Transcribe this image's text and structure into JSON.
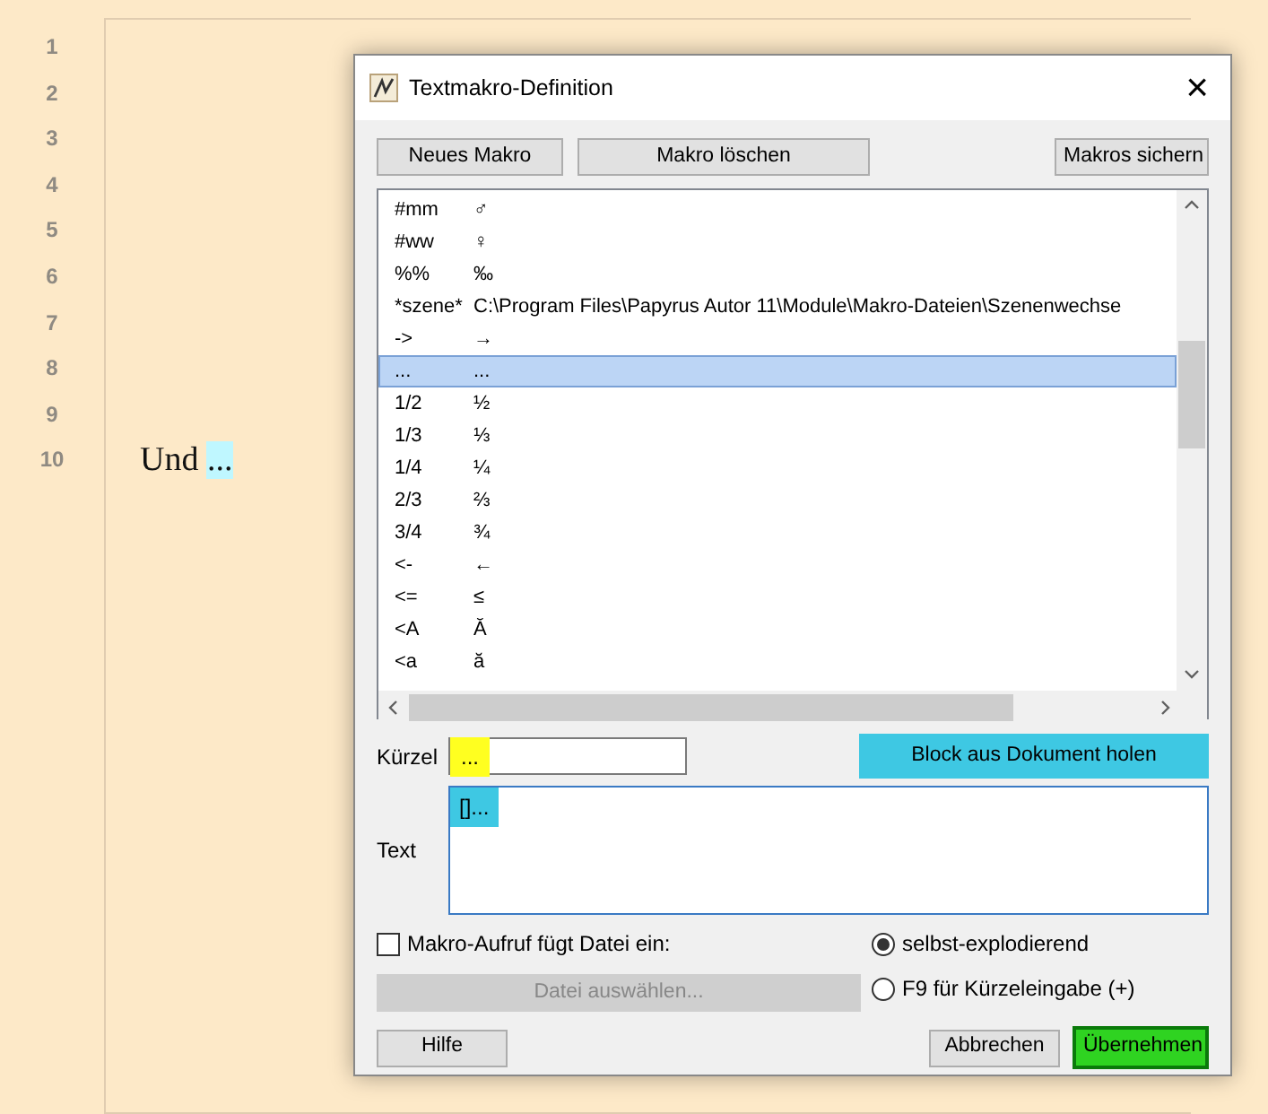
{
  "editor": {
    "line_numbers": [
      "1",
      "2",
      "3",
      "4",
      "5",
      "6",
      "7",
      "8",
      "9",
      "10"
    ],
    "text": "Und",
    "highlighted_text": "..."
  },
  "dialog": {
    "title": "Textmakro-Definition",
    "close": "×",
    "top_buttons": [
      "Neues Makro",
      "Makro löschen",
      "Makros sichern"
    ],
    "macros": [
      {
        "shortcut": "#mm",
        "text": "♂",
        "selected": false
      },
      {
        "shortcut": "#ww",
        "text": "♀",
        "selected": false
      },
      {
        "shortcut": "%%",
        "text": "‰",
        "selected": false
      },
      {
        "shortcut": "*szene*",
        "text": "C:\\Program Files\\Papyrus Autor 11\\Module\\Makro-Dateien\\Szenenwechse",
        "selected": false
      },
      {
        "shortcut": "->",
        "text": "→",
        "selected": false
      },
      {
        "shortcut": "...",
        "text": "...",
        "selected": true
      },
      {
        "shortcut": "1/2",
        "text": "½",
        "selected": false
      },
      {
        "shortcut": "1/3",
        "text": "⅓",
        "selected": false
      },
      {
        "shortcut": "1/4",
        "text": "¼",
        "selected": false
      },
      {
        "shortcut": "2/3",
        "text": "⅔",
        "selected": false
      },
      {
        "shortcut": "3/4",
        "text": "¾",
        "selected": false
      },
      {
        "shortcut": "<-",
        "text": "←",
        "selected": false
      },
      {
        "shortcut": "<=",
        "text": "≤",
        "selected": false
      },
      {
        "shortcut": "<A",
        "text": "Ă",
        "selected": false
      },
      {
        "shortcut": "<a",
        "text": "ă",
        "selected": false
      }
    ],
    "kuerzel": {
      "label": "Kürzel",
      "value": "...",
      "highlighted": true
    },
    "block_button": {
      "label": "Block aus Dokument holen",
      "highlighted": true
    },
    "text_field": {
      "label": "Text",
      "value": "[]...",
      "highlighted": true
    },
    "file_checkbox": {
      "label": "Makro-Aufruf fügt Datei ein:",
      "checked": false
    },
    "file_button": {
      "label": "Datei auswählen...",
      "disabled": true
    },
    "modes": [
      {
        "label": "selbst-explodierend",
        "selected": true
      },
      {
        "label": "F9 für Kürzeleingabe (+)",
        "selected": false
      }
    ],
    "help_button": "Hilfe",
    "cancel_button": {
      "label": "Abbrechen",
      "highlighted": false
    },
    "apply_button": {
      "label": "Übernehmen",
      "highlighted": true
    }
  }
}
